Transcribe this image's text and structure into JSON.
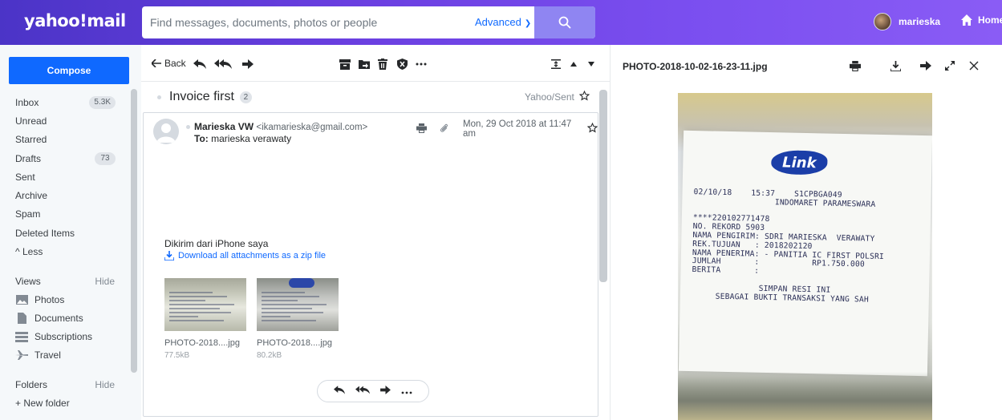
{
  "header": {
    "logo": "yahoo!mail",
    "search_placeholder": "Find messages, documents, photos or people",
    "advanced_label": "Advanced",
    "user_name": "marieska",
    "home_label": "Home"
  },
  "sidebar": {
    "compose_label": "Compose",
    "folders": [
      {
        "label": "Inbox",
        "badge": "5.3K"
      },
      {
        "label": "Unread",
        "badge": ""
      },
      {
        "label": "Starred",
        "badge": ""
      },
      {
        "label": "Drafts",
        "badge": "73"
      },
      {
        "label": "Sent",
        "badge": ""
      },
      {
        "label": "Archive",
        "badge": ""
      },
      {
        "label": "Spam",
        "badge": ""
      },
      {
        "label": "Deleted Items",
        "badge": ""
      },
      {
        "label": "^ Less",
        "badge": ""
      }
    ],
    "views_label": "Views",
    "views_hide": "Hide",
    "views": [
      {
        "label": "Photos",
        "icon": "photos-icon"
      },
      {
        "label": "Documents",
        "icon": "documents-icon"
      },
      {
        "label": "Subscriptions",
        "icon": "subscriptions-icon"
      },
      {
        "label": "Travel",
        "icon": "travel-icon"
      }
    ],
    "folders_label": "Folders",
    "folders_hide": "Hide",
    "new_folder": "+ New folder"
  },
  "toolbar": {
    "back_label": "Back"
  },
  "message": {
    "subject": "Invoice first",
    "thread_count": "2",
    "folder_tag": "Yahoo/Sent",
    "sender_name": "Marieska VW",
    "sender_email": "<ikamarieska@gmail.com>",
    "to_label": "To:",
    "to_name": "marieska verawaty",
    "date": "Mon, 29 Oct 2018 at 11:47 am",
    "body": "Dikirim dari iPhone saya",
    "download_all": "Download all attachments as a zip file",
    "attachments": [
      {
        "name": "PHOTO-2018....jpg",
        "size": "77.5kB"
      },
      {
        "name": "PHOTO-2018....jpg",
        "size": "80.2kB"
      }
    ]
  },
  "preview": {
    "filename": "PHOTO-2018-10-02-16-23-11.jpg",
    "receipt_logo": "Link",
    "receipt_lines": "02/10/18    15:37    S1CPBGA049\n                 INDOMARET PARAMESWARA\n\n****220102771478\nNO. REKORD 5903\nNAMA PENGIRIM: SDRI MARIESKA  VERAWATY\nREK.TUJUAN   : 2018202120\nNAMA PENERIMA: - PANITIA IC FIRST POLSRI\nJUMLAH       :           RP1.750.000\nBERITA       :\n\n              SIMPAN RESI INI\n     SEBAGAI BUKTI TRANSAKSI YANG SAH"
  },
  "colors": {
    "accent": "#0f69ff",
    "header_start": "#4b34c7",
    "header_end": "#8a5cf5"
  }
}
